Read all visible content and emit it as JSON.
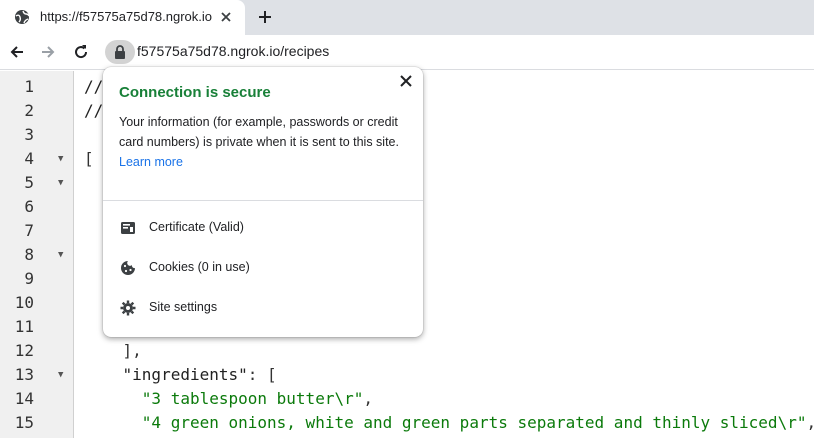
{
  "tab": {
    "title": "https://f57575a75d78.ngrok.io"
  },
  "address_bar": {
    "url": "f57575a75d78.ngrok.io/recipes"
  },
  "code_lines": [
    {
      "ln": "1",
      "fold": false,
      "html": "<span class=\"key\">//</span>"
    },
    {
      "ln": "2",
      "fold": false,
      "html": "<span class=\"key\">//</span>"
    },
    {
      "ln": "3",
      "fold": false,
      "html": ""
    },
    {
      "ln": "4",
      "fold": true,
      "html": "["
    },
    {
      "ln": "5",
      "fold": true,
      "html": ""
    },
    {
      "ln": "6",
      "fold": false,
      "html": ""
    },
    {
      "ln": "7",
      "fold": false,
      "html": ""
    },
    {
      "ln": "8",
      "fold": true,
      "html": ""
    },
    {
      "ln": "9",
      "fold": false,
      "html": ""
    },
    {
      "ln": "10",
      "fold": false,
      "html": ""
    },
    {
      "ln": "11",
      "fold": false,
      "html": ""
    },
    {
      "ln": "12",
      "fold": false,
      "html": "    ],"
    },
    {
      "ln": "13",
      "fold": true,
      "html": "    <span class=\"key\">\"ingredients\"</span>: ["
    },
    {
      "ln": "14",
      "fold": false,
      "html": "      <span class=\"str\">\"3 tablespoon butter\\r\"</span>,"
    },
    {
      "ln": "15",
      "fold": false,
      "html": "      <span class=\"str\">\"4 green onions, white and green parts separated and thinly sliced\\r\"</span>,"
    }
  ],
  "popup": {
    "title": "Connection is secure",
    "description": "Your information (for example, passwords or credit card numbers) is private when it is sent to this site.",
    "learn_more": "Learn more",
    "items": [
      {
        "label": "Certificate (Valid)",
        "icon": "certificate-icon"
      },
      {
        "label": "Cookies (0 in use)",
        "icon": "cookie-icon"
      },
      {
        "label": "Site settings",
        "icon": "gear-icon"
      }
    ]
  },
  "colors": {
    "secure_green": "#188038",
    "link_blue": "#1a73e8",
    "string_green": "#0b7a0b"
  }
}
